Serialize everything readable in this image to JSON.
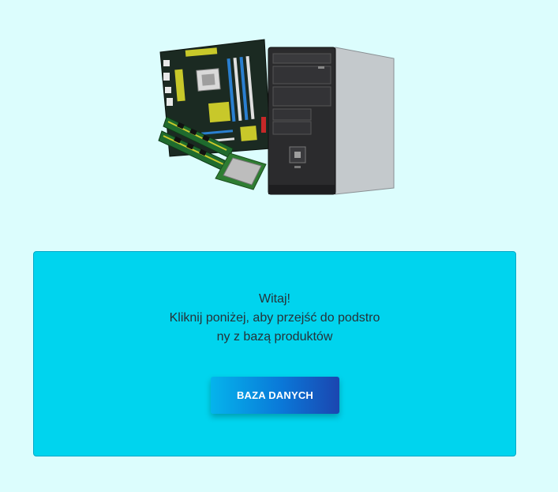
{
  "hero": {
    "image_name": "computer-parts-illustration"
  },
  "welcome": {
    "line1": "Witaj!",
    "line2": "Kliknij poniżej, aby przejść do podstro",
    "line3": "ny z bazą produktów"
  },
  "button": {
    "label": "BAZA DANYCH"
  },
  "colors": {
    "background": "#dcfdfd",
    "card": "#00d4ee",
    "button_start": "#05b4ec",
    "button_end": "#1b46b0"
  }
}
